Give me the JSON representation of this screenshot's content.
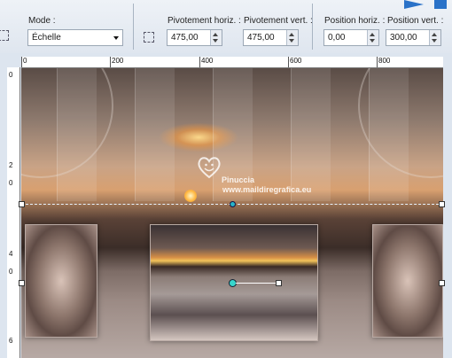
{
  "toolbar": {
    "mode_label": "Mode :",
    "mode_value": "Échelle",
    "pivot_h_label": "Pivotement horiz. :",
    "pivot_h_value": "475,00",
    "pivot_v_label": "Pivotement vert. :",
    "pivot_v_value": "475,00",
    "pos_h_label": "Position horiz. :",
    "pos_h_value": "0,00",
    "pos_v_label": "Position vert. :",
    "pos_v_value": "300,00"
  },
  "ruler": {
    "horizontal_labels": [
      "0",
      "200",
      "400",
      "600",
      "800"
    ],
    "vertical_labels": [
      "0",
      "2",
      "0",
      "4",
      "0",
      "6"
    ]
  },
  "watermark": {
    "line1": "Pinuccia",
    "line2": "www.maildiregrafica.eu"
  }
}
